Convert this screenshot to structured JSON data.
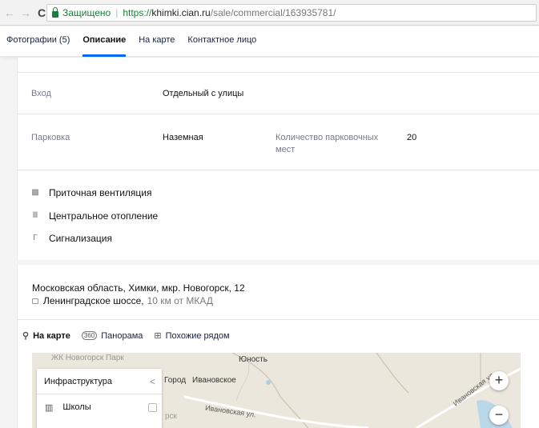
{
  "browser": {
    "back": "←",
    "forward": "→",
    "reload": "C",
    "secure_label": "Защищено",
    "separator": "|",
    "url_proto": "https://",
    "url_host": "khimki.cian.ru",
    "url_path": "/sale/commercial/163935781/"
  },
  "tabs": [
    {
      "label": "Фотографии (5)"
    },
    {
      "label": "Описание"
    },
    {
      "label": "На карте"
    },
    {
      "label": "Контактное лицо"
    }
  ],
  "details": {
    "entrance": {
      "label": "Вход",
      "value": "Отдельный с улицы"
    },
    "parking": {
      "label": "Парковка",
      "value": "Наземная",
      "count_label_1": "Количество парковочных",
      "count_label_2": "мест",
      "count_value": "20"
    }
  },
  "features": [
    {
      "icon": "ventilation-icon",
      "glyph": "▩",
      "label": "Приточная вентиляция"
    },
    {
      "icon": "heating-icon",
      "glyph": "Ⅲ",
      "label": "Центральное отопление"
    },
    {
      "icon": "alarm-icon",
      "glyph": "Г",
      "label": "Сигнализация"
    }
  ],
  "address": {
    "line": "Московская область, Химки, мкр. Новогорск, 12",
    "highway": "Ленинградское шоссе,",
    "distance": "10 км от МКАД"
  },
  "map_tabs": [
    {
      "icon": "pin-icon",
      "glyph": "⚲",
      "label": "На карте"
    },
    {
      "icon": "panorama-icon",
      "glyph": "360",
      "label": "Панорама"
    },
    {
      "icon": "grid-icon",
      "glyph": "⊞",
      "label": "Похожие рядом"
    }
  ],
  "map": {
    "labels": {
      "park": "ЖК Новогорск Парк",
      "youth": "Юность",
      "city": "Город",
      "ivanovskoe": "Ивановское",
      "ivan_ul": "Ивановская ул.",
      "ivan_ul_2": "Ивановская ул.",
      "park_fragment": "рск"
    },
    "infra_title": "Инфраструктура",
    "infra_chev": "<",
    "infra_items": [
      {
        "icon": "school-icon",
        "glyph": "▥",
        "label": "Школы"
      }
    ],
    "zoom_in": "+",
    "zoom_out": "−"
  }
}
